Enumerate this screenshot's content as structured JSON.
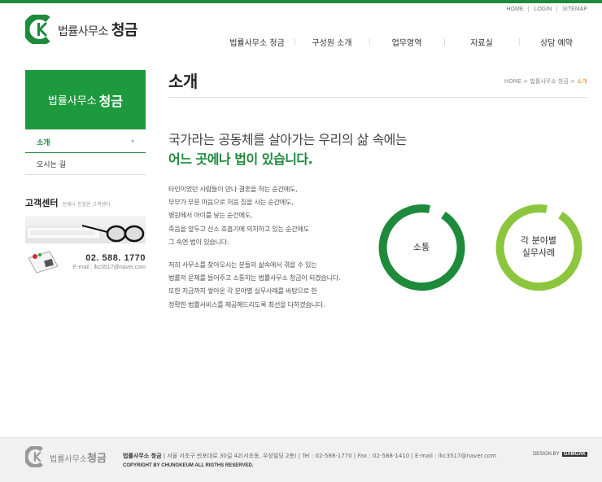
{
  "util_links": [
    "HOME",
    "LOGIN",
    "SITEMAP"
  ],
  "logo": {
    "prefix": "법률사무소",
    "name": "청금"
  },
  "nav": [
    "법률사무소 청금",
    "구성원 소개",
    "업무영역",
    "자료실",
    "상담 예약"
  ],
  "side_banner": {
    "prefix": "법률사무소",
    "name": "청금"
  },
  "side_menu": [
    {
      "label": "소개",
      "arrow": "›"
    },
    {
      "label": "오시는 길"
    }
  ],
  "customer_center": {
    "title": "고객센터",
    "subtitle": "언제나 친절한 고객센터",
    "phone": "02. 588. 1770",
    "email": "E-mail : lkc3517@naver.com"
  },
  "page_title": "소개",
  "breadcrumb": {
    "home": "HOME",
    "sep": ">",
    "section": "법률사무소 청금",
    "current": "소개"
  },
  "headline": {
    "line1": "국가라는 공동체를 살아가는 우리의 삶 속에는",
    "line2": "어느 곳에나 법이 있습니다."
  },
  "paragraph1": [
    "타인이었던 사람들이 만나 결혼을 하는 순간에도,",
    "부부가 부푼 마음으로 처음 집을 사는 순간에도,",
    "병원에서 아이를 낳는 순간에도,",
    "죽음을 앞두고 산소 호흡기에 의지하고 있는 순간에도",
    "그 속엔 법이 있습니다."
  ],
  "paragraph2": [
    "저희 사무소를 찾아오시는 분들의 삶속에서 겪을 수 있는",
    "법률적 문제를 들어주고 소통하는 법률사무소 청금이 되겠습니다.",
    "또한 지금까지 쌓아온 각 분야별 실무사례를 바탕으로 한",
    "정확한 법률서비스를 제공해드리도록 최선을 다하겠습니다."
  ],
  "circles": [
    {
      "label": "소통",
      "color": "#1e8a3c"
    },
    {
      "label": "각 분야별\n실무사례",
      "color": "#8cc63f"
    }
  ],
  "footer": {
    "logo_prefix": "법률사무소",
    "logo_name": "청금",
    "address_name": "법률사무소 청금",
    "address_rest": " | 서울 서초구 반포대로 30길 42(서초동, 우성빌딩 2층) | Tel : 02-588-1770 | Fax : 02-588-1410 | E-mail : lkc3517@naver.com",
    "copyright": "COPYRIGHT BY CHUNGKEUM ALL RIGTHS RESERVED.",
    "design_by": "DESIGN BY",
    "design_badge": "GAMGAK"
  },
  "colors": {
    "brand": "#1e8a3c",
    "light_green": "#8cc63f",
    "breadcrumb_current": "#e08a1e"
  }
}
